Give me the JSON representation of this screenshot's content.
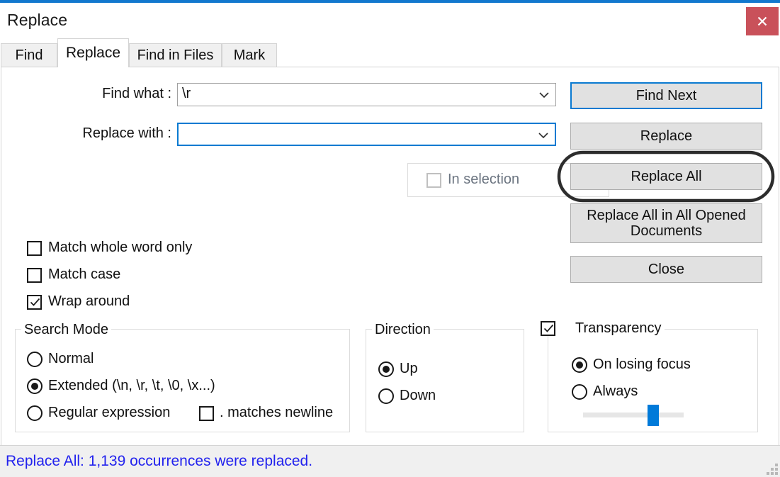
{
  "window": {
    "title": "Replace",
    "close_label": "×",
    "accent_color": "#1278ce",
    "close_color": "#c9515a"
  },
  "tabs": [
    {
      "label": "Find",
      "active": false
    },
    {
      "label": "Replace",
      "active": true
    },
    {
      "label": "Find in Files",
      "active": false
    },
    {
      "label": "Mark",
      "active": false
    }
  ],
  "fields": {
    "find_what_label": "Find what :",
    "find_what_value": "\\r",
    "replace_with_label": "Replace with :",
    "replace_with_value": "",
    "replace_with_placeholder": ""
  },
  "buttons": {
    "find_next": "Find Next",
    "replace": "Replace",
    "replace_all": "Replace All",
    "replace_all_opened": "Replace All in All Opened Documents",
    "close": "Close"
  },
  "in_selection": {
    "label": "In selection",
    "checked": false,
    "disabled": true
  },
  "options": [
    {
      "label": "Match whole word only",
      "checked": false
    },
    {
      "label": "Match case",
      "checked": false
    },
    {
      "label": "Wrap around",
      "checked": true
    }
  ],
  "search_mode": {
    "title": "Search Mode",
    "items": [
      {
        "label": "Normal",
        "selected": false
      },
      {
        "label": "Extended (\\n, \\r, \\t, \\0, \\x...)",
        "selected": true
      },
      {
        "label": "Regular expression",
        "selected": false
      }
    ],
    "dot_matches_newline": {
      "label": ". matches newline",
      "checked": false
    }
  },
  "direction": {
    "title": "Direction",
    "items": [
      {
        "label": "Up",
        "selected": true
      },
      {
        "label": "Down",
        "selected": false
      }
    ]
  },
  "transparency": {
    "title": "Transparency",
    "checked": true,
    "items": [
      {
        "label": "On losing focus",
        "selected": true
      },
      {
        "label": "Always",
        "selected": false
      }
    ],
    "slider_percent": 64,
    "slider_color": "#007ad9"
  },
  "status": {
    "message": "Replace All: 1,139 occurrences were replaced.",
    "color": "#2222ee"
  },
  "annotation": {
    "shape": "ellipse",
    "target": "Replace All",
    "color": "#2d2d2d"
  }
}
